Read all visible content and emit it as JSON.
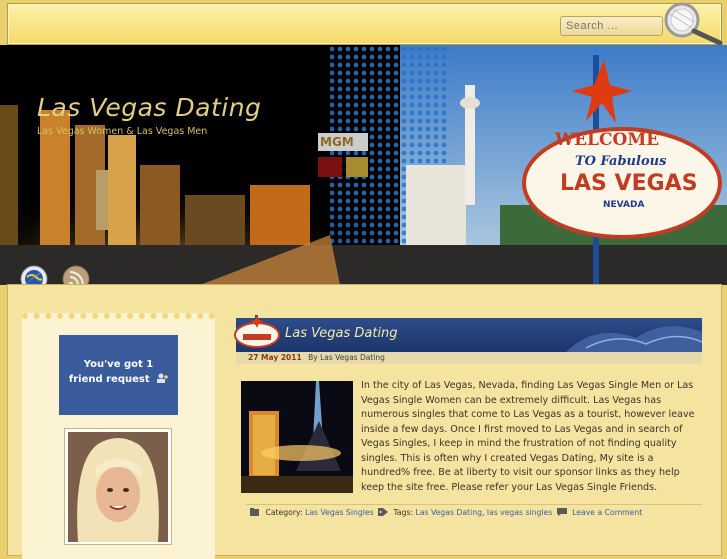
{
  "search": {
    "placeholder": "Search ..."
  },
  "header": {
    "title": "Las Vegas Dating",
    "tagline": "Las Vegas Women & Las Vegas Men",
    "sign": {
      "line1": "WELCOME",
      "line2": "TO Fabulous",
      "line3": "LAS VEGAS",
      "line4": "NEVADA"
    },
    "mgm": "MGM"
  },
  "nav": [
    {
      "icon": "globe-icon"
    },
    {
      "icon": "rss-icon"
    }
  ],
  "sidebar": {
    "friend_request_line1": "You've got 1",
    "friend_request_line2": "friend request"
  },
  "post": {
    "title": "Las Vegas Dating",
    "date": "27 May 2011",
    "by": "By Las Vegas Dating",
    "body": "In the city of Las Vegas, Nevada, finding Las Vegas Single Men or Las Vegas Single Women can be extremely difficult. Las Vegas has numerous singles that come to Las Vegas as a tourist, however leave inside a few days. Once I first moved to Las Vegas and in search of Vegas Singles, I keep in mind the frustration of not finding quality singles. This is often why I created Vegas Dating, My site is a hundred% free. Be at liberty to visit our sponsor links as they help keep the site free. Please refer your Las Vegas Single Friends.",
    "category_label": "Category:",
    "category": "Las Vegas Singles",
    "tags_label": "Tags:",
    "tag1": "Las Vegas Dating",
    "tag_sep": ",",
    "tag2": "las vegas singles",
    "comment": "Leave a Comment"
  }
}
